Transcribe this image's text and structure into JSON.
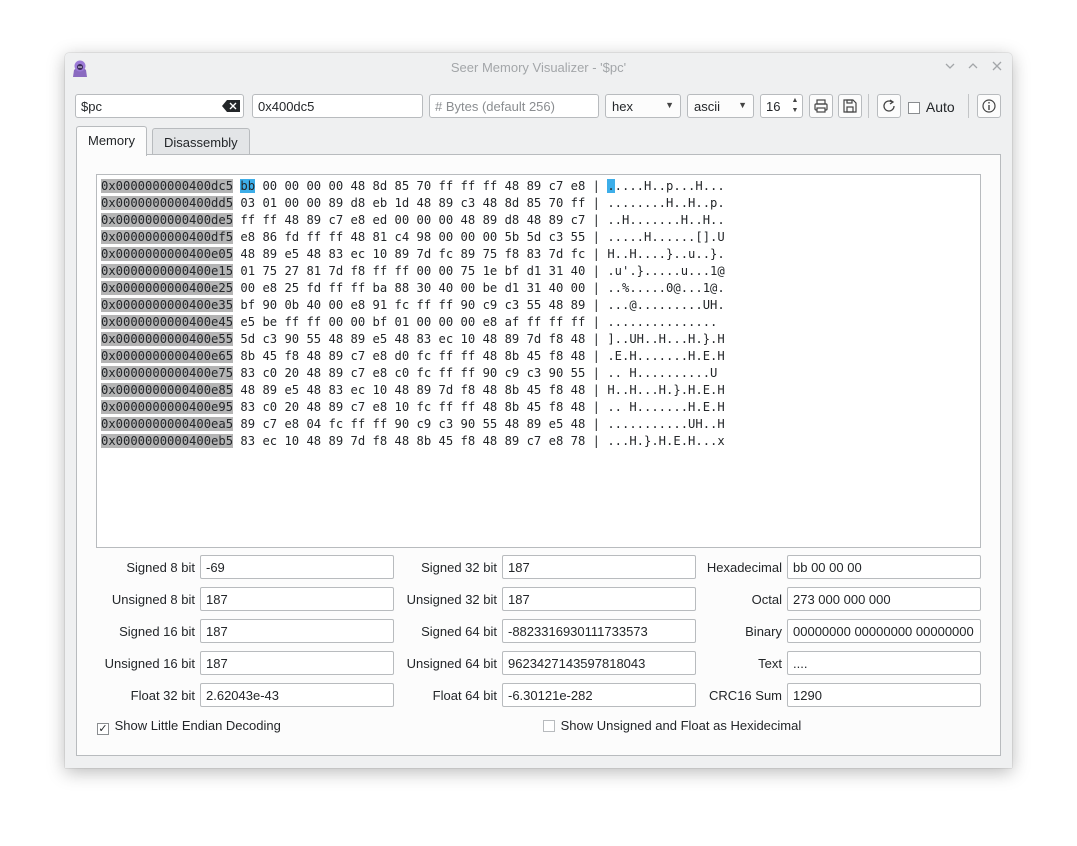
{
  "window": {
    "title": "Seer Memory Visualizer - '$pc'",
    "controls": [
      "chevron-down",
      "chevron-up",
      "close"
    ]
  },
  "toolbar": {
    "expression": "$pc",
    "address": "0x400dc5",
    "bytes_placeholder": "# Bytes (default 256)",
    "format": "hex",
    "charset": "ascii",
    "column_count": "16",
    "auto_label": "Auto",
    "auto_checked": false
  },
  "tabs": [
    {
      "label": "Memory",
      "active": true
    },
    {
      "label": "Disassembly",
      "active": false
    }
  ],
  "hexdump": {
    "lines": [
      {
        "addr": "0x0000000000400dc5",
        "first": "bb",
        "rest": " 00 00 00 00 48 8d 85 70 ff ff ff 48 89 c7 e8",
        "sep": " | ",
        "ascii_first": ".",
        "ascii_rest": "....H..p...H..."
      },
      {
        "addr": "0x0000000000400dd5",
        "first": "03",
        "rest": " 01 00 00 89 d8 eb 1d 48 89 c3 48 8d 85 70 ff",
        "sep": " | ",
        "ascii_first": ".",
        "ascii_rest": ".......H..H..p."
      },
      {
        "addr": "0x0000000000400de5",
        "first": "ff",
        "rest": " ff 48 89 c7 e8 ed 00 00 00 48 89 d8 48 89 c7",
        "sep": " | ",
        "ascii_first": ".",
        "ascii_rest": ".H.......H..H.."
      },
      {
        "addr": "0x0000000000400df5",
        "first": "e8",
        "rest": " 86 fd ff ff 48 81 c4 98 00 00 00 5b 5d c3 55",
        "sep": " | ",
        "ascii_first": ".",
        "ascii_rest": "....H......[].U"
      },
      {
        "addr": "0x0000000000400e05",
        "first": "48",
        "rest": " 89 e5 48 83 ec 10 89 7d fc 89 75 f8 83 7d fc",
        "sep": " | ",
        "ascii_first": "H",
        "ascii_rest": "..H....}..u..}."
      },
      {
        "addr": "0x0000000000400e15",
        "first": "01",
        "rest": " 75 27 81 7d f8 ff ff 00 00 75 1e bf d1 31 40",
        "sep": " | ",
        "ascii_first": ".",
        "ascii_rest": "u'.}.....u...1@"
      },
      {
        "addr": "0x0000000000400e25",
        "first": "00",
        "rest": " e8 25 fd ff ff ba 88 30 40 00 be d1 31 40 00",
        "sep": " | ",
        "ascii_first": ".",
        "ascii_rest": ".%.....0@...1@."
      },
      {
        "addr": "0x0000000000400e35",
        "first": "bf",
        "rest": " 90 0b 40 00 e8 91 fc ff ff 90 c9 c3 55 48 89",
        "sep": " | ",
        "ascii_first": ".",
        "ascii_rest": "..@.........UH."
      },
      {
        "addr": "0x0000000000400e45",
        "first": "e5",
        "rest": " be ff ff 00 00 bf 01 00 00 00 e8 af ff ff ff",
        "sep": " | ",
        "ascii_first": ".",
        "ascii_rest": ".............."
      },
      {
        "addr": "0x0000000000400e55",
        "first": "5d",
        "rest": " c3 90 55 48 89 e5 48 83 ec 10 48 89 7d f8 48",
        "sep": " | ",
        "ascii_first": "]",
        "ascii_rest": "..UH..H...H.}.H"
      },
      {
        "addr": "0x0000000000400e65",
        "first": "8b",
        "rest": " 45 f8 48 89 c7 e8 d0 fc ff ff 48 8b 45 f8 48",
        "sep": " | ",
        "ascii_first": ".",
        "ascii_rest": "E.H.......H.E.H"
      },
      {
        "addr": "0x0000000000400e75",
        "first": "83",
        "rest": " c0 20 48 89 c7 e8 c0 fc ff ff 90 c9 c3 90 55",
        "sep": " | ",
        "ascii_first": ".",
        "ascii_rest": ". H..........U"
      },
      {
        "addr": "0x0000000000400e85",
        "first": "48",
        "rest": " 89 e5 48 83 ec 10 48 89 7d f8 48 8b 45 f8 48",
        "sep": " | ",
        "ascii_first": "H",
        "ascii_rest": "..H...H.}.H.E.H"
      },
      {
        "addr": "0x0000000000400e95",
        "first": "83",
        "rest": " c0 20 48 89 c7 e8 10 fc ff ff 48 8b 45 f8 48",
        "sep": " | ",
        "ascii_first": ".",
        "ascii_rest": ". H.......H.E.H"
      },
      {
        "addr": "0x0000000000400ea5",
        "first": "89",
        "rest": " c7 e8 04 fc ff ff 90 c9 c3 90 55 48 89 e5 48",
        "sep": " | ",
        "ascii_first": ".",
        "ascii_rest": "..........UH..H"
      },
      {
        "addr": "0x0000000000400eb5",
        "first": "83",
        "rest": " ec 10 48 89 7d f8 48 8b 45 f8 48 89 c7 e8 78",
        "sep": " | ",
        "ascii_first": ".",
        "ascii_rest": "..H.}.H.E.H...x"
      }
    ]
  },
  "decoding": {
    "col1": [
      {
        "label": "Signed 8 bit",
        "value": "-69"
      },
      {
        "label": "Unsigned 8 bit",
        "value": "187"
      },
      {
        "label": "Signed 16 bit",
        "value": "187"
      },
      {
        "label": "Unsigned 16 bit",
        "value": "187"
      },
      {
        "label": "Float 32 bit",
        "value": "2.62043e-43"
      }
    ],
    "col2": [
      {
        "label": "Signed 32 bit",
        "value": "187"
      },
      {
        "label": "Unsigned 32 bit",
        "value": "187"
      },
      {
        "label": "Signed 64 bit",
        "value": "-8823316930111733573"
      },
      {
        "label": "Unsigned 64 bit",
        "value": "9623427143597818043"
      },
      {
        "label": "Float 64 bit",
        "value": "-6.30121e-282"
      }
    ],
    "col3": [
      {
        "label": "Hexadecimal",
        "value": "bb 00 00 00"
      },
      {
        "label": "Octal",
        "value": "273 000 000 000"
      },
      {
        "label": "Binary",
        "value": "00000000 00000000 00000000"
      },
      {
        "label": "Text",
        "value": "...."
      },
      {
        "label": "CRC16 Sum",
        "value": "1290"
      }
    ]
  },
  "options": {
    "little_endian_label": "Show Little Endian Decoding",
    "little_endian_checked": true,
    "unsigned_hex_label": "Show Unsigned and Float as Hexidecimal",
    "unsigned_hex_checked": false
  },
  "colors": {
    "selection": "#3daee9",
    "address_bg": "#b4b4b4",
    "window_bg": "#eff0f1"
  }
}
